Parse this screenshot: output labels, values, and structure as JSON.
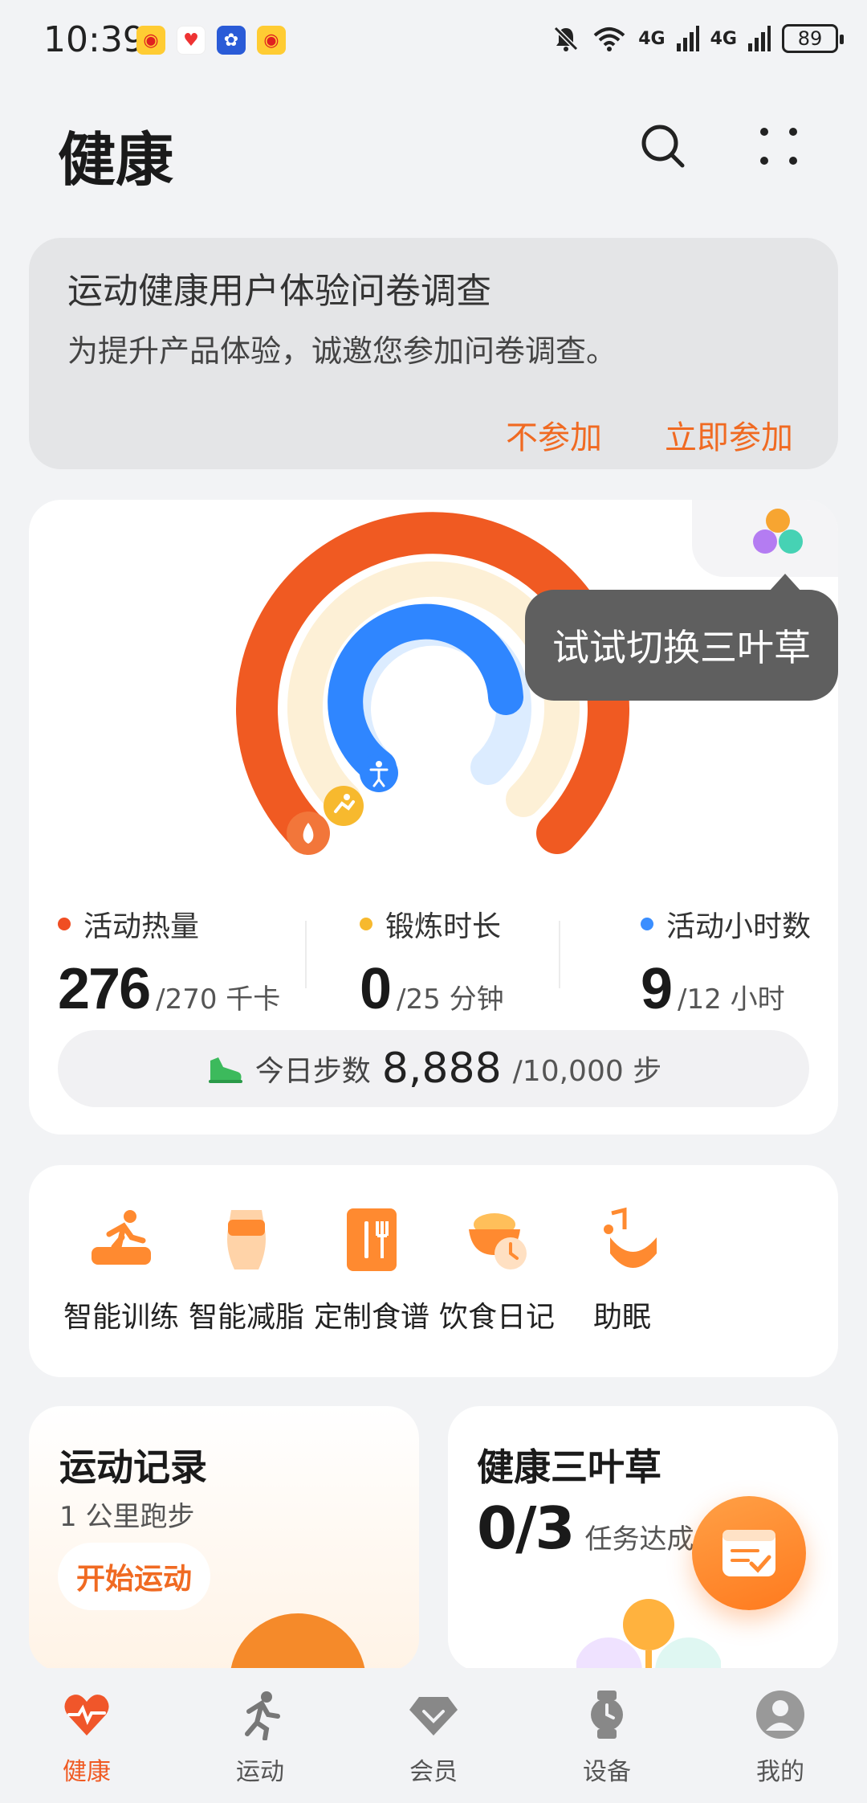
{
  "status_bar": {
    "time": "10:39",
    "battery": "89",
    "signal1": "4G",
    "signal2": "4G",
    "notifications": [
      "weibo-icon",
      "health-icon",
      "app-icon",
      "weibo-icon"
    ]
  },
  "header": {
    "title": "健康",
    "search_icon": "search-icon",
    "more_icon": "more-dots-icon"
  },
  "survey": {
    "title": "运动健康用户体验问卷调查",
    "description": "为提升产品体验，诚邀您参加问卷调查。",
    "decline_label": "不参加",
    "join_label": "立即参加",
    "accent_color": "#f06a22"
  },
  "rings": {
    "tooltip": "试试切换三叶草",
    "colors": {
      "calories": "#f04e23",
      "exercise": "#f7b92e",
      "active_hours": "#3a8eff"
    },
    "stats": [
      {
        "label": "活动热量",
        "value": "276",
        "goal": "/270 千卡",
        "color": "#f04e23",
        "progress": 1.02
      },
      {
        "label": "锻炼时长",
        "value": "0",
        "goal": "/25 分钟",
        "color": "#f7b92e",
        "progress": 0.0
      },
      {
        "label": "活动小时数",
        "value": "9",
        "goal": "/12 小时",
        "color": "#3a8eff",
        "progress": 0.75
      }
    ]
  },
  "steps": {
    "label": "今日步数",
    "value": "8,888",
    "goal": "/10,000 步"
  },
  "services": [
    {
      "label": "智能训练",
      "icon": "running-trainer-icon"
    },
    {
      "label": "智能减脂",
      "icon": "body-fat-icon"
    },
    {
      "label": "定制食谱",
      "icon": "recipe-book-icon"
    },
    {
      "label": "饮食日记",
      "icon": "food-bowl-clock-icon"
    },
    {
      "label": "助眠",
      "icon": "music-sleep-icon"
    }
  ],
  "exercise_record": {
    "title": "运动记录",
    "subtitle": "1 公里跑步",
    "button": "开始运动"
  },
  "clover": {
    "title": "健康三叶草",
    "value": "0/3",
    "suffix": "任务达成"
  },
  "bottom_nav": [
    {
      "label": "健康",
      "icon": "heart-icon",
      "active": true
    },
    {
      "label": "运动",
      "icon": "runner-icon",
      "active": false
    },
    {
      "label": "会员",
      "icon": "diamond-icon",
      "active": false
    },
    {
      "label": "设备",
      "icon": "watch-icon",
      "active": false
    },
    {
      "label": "我的",
      "icon": "avatar-icon",
      "active": false
    }
  ]
}
